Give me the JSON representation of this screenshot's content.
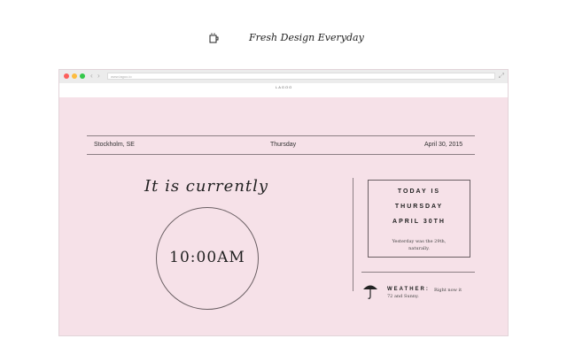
{
  "tagline": {
    "text": "Fresh Design Everyday",
    "icon": "coffee-cup-icon"
  },
  "browser": {
    "url": "www.lagoo.io",
    "nav_back": "‹",
    "nav_forward": "›",
    "expand": "⤢",
    "traffic_colors": [
      "#fc605c",
      "#fdbc40",
      "#34c84a"
    ]
  },
  "app": {
    "logo": "LAGOO",
    "location": "Stockholm, SE",
    "weekday": "Thursday",
    "date": "April 30, 2015",
    "heading": "It is currently",
    "time": "10:00AM",
    "today": {
      "line1": "TODAY IS",
      "line2": "THURSDAY",
      "line3": "APRIL 30TH",
      "yesterday": "Yesterday was the 29th,",
      "yesterday2": "naturally."
    },
    "weather": {
      "label": "WEATHER:",
      "text": "Right now it",
      "text2": "72 and Sunny.",
      "icon": "umbrella-icon"
    },
    "colors": {
      "background": "#f6e1e8",
      "rule": "#8c7f84"
    }
  }
}
